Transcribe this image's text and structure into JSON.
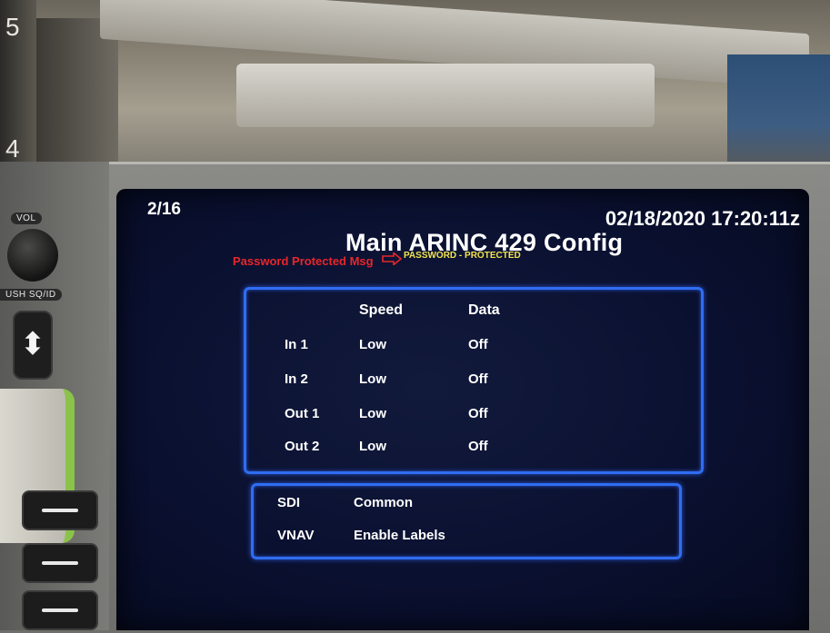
{
  "hardware": {
    "vol_label": "VOL",
    "push_label": "USH SQ/ID",
    "updown_glyph": "⬍",
    "rack_numbers": [
      "5",
      "4"
    ]
  },
  "screen": {
    "page_indicator": "2/16",
    "datetime": "02/18/2020 17:20:11z",
    "title": "Main ARINC 429 Config",
    "annotation": "Password Protected Msg",
    "annotation_color": "#e8262a",
    "password_message": "PASSWORD - PROTECTED",
    "password_message_color": "#f2e34c",
    "panel_border_color": "#2f6df2"
  },
  "config_table": {
    "headers": [
      "Speed",
      "Data"
    ],
    "rows": [
      {
        "label": "In 1",
        "speed": "Low",
        "data": "Off"
      },
      {
        "label": "In 2",
        "speed": "Low",
        "data": "Off"
      },
      {
        "label": "Out 1",
        "speed": "Low",
        "data": "Off"
      },
      {
        "label": "Out 2",
        "speed": "Low",
        "data": "Off"
      }
    ]
  },
  "settings": [
    {
      "label": "SDI",
      "value": "Common"
    },
    {
      "label": "VNAV",
      "value": "Enable Labels"
    }
  ]
}
